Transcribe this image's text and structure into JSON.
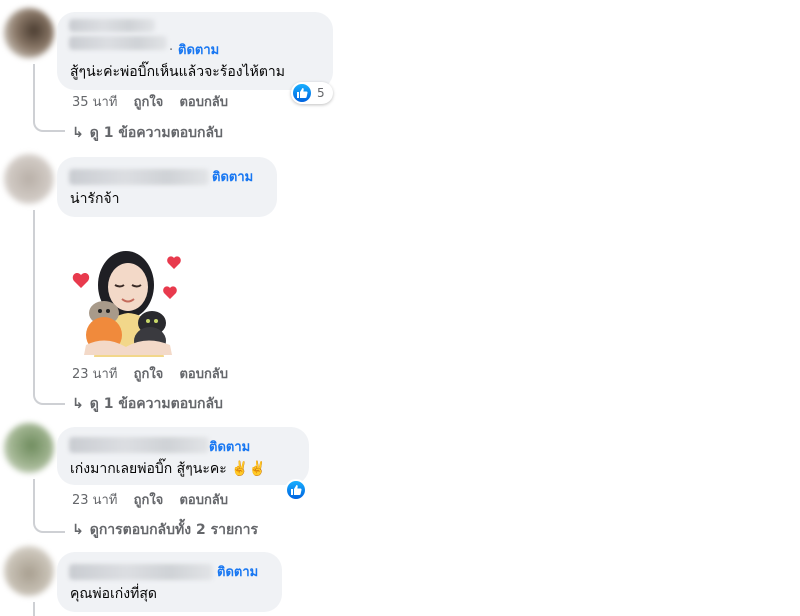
{
  "follow_label": "ติดตาม",
  "like_label": "ถูกใจ",
  "reply_label": "ตอบกลับ",
  "comments": [
    {
      "follow_prefix": "·",
      "text": "สู้ๆน่ะค่ะพ่อบิ๊กเห็นแล้วจะร้องไห้ตาม",
      "time": "35 นาที",
      "reaction_count": "5",
      "view_replies": "ดู 1 ข้อความตอบกลับ"
    },
    {
      "text": "น่ารักจ้า",
      "time": "23 นาที",
      "view_replies": "ดู 1 ข้อความตอบกลับ"
    },
    {
      "text": "เก่งมากเลยพ่อบิ๊ก สู้ๆนะคะ",
      "emoji": "✌️✌️",
      "time": "23 นาที",
      "view_replies": "ดูการตอบกลับทั้ง 2 รายการ"
    },
    {
      "text": "คุณพ่อเก่งที่สุด"
    }
  ],
  "icons": [
    "like-reaction-icon",
    "reply-arrow-icon",
    "heart-icon"
  ],
  "colors": {
    "link": "#1877f2",
    "bubble": "#f0f2f5",
    "meta": "#65676b",
    "like": "#1877f2"
  }
}
